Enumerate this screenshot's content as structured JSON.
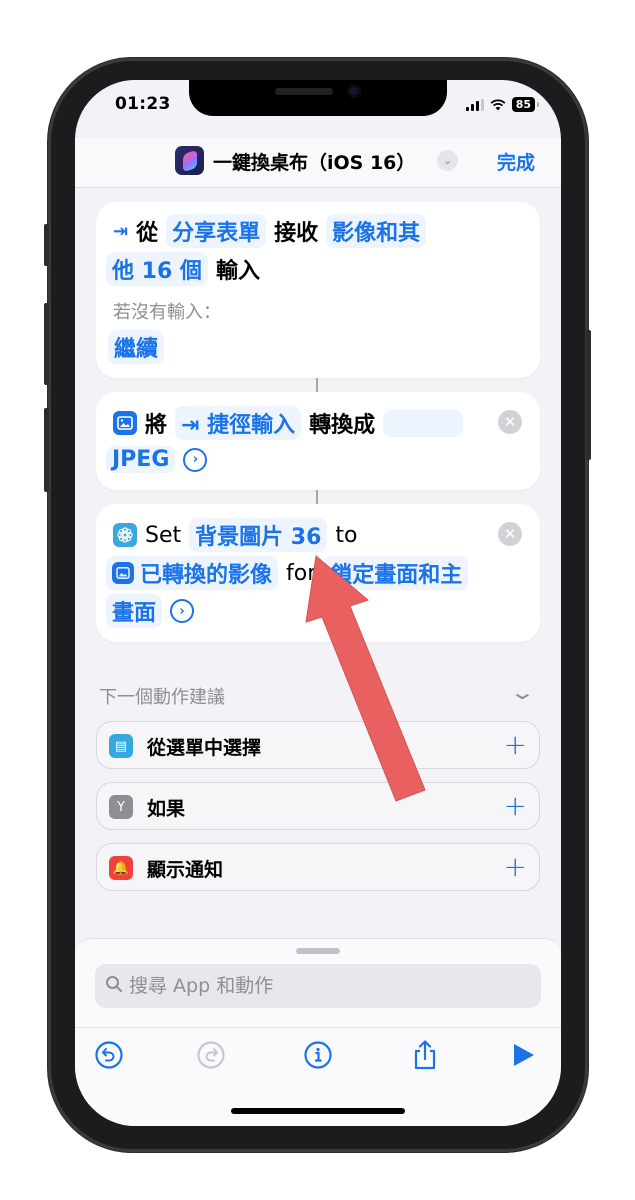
{
  "status_bar": {
    "time": "01:23",
    "battery": "85",
    "signal_bars_filled": 3,
    "signal_bars_total": 4
  },
  "nav": {
    "app_icon": "shortcuts-app-icon",
    "title": "一鍵換桌布（iOS 16）",
    "chevron_icon": "chevron-down-icon",
    "done_label": "完成"
  },
  "actions": [
    {
      "icon": "input-arrow-icon",
      "prefix": "從",
      "source_token": "分享表單",
      "verb": "接收",
      "type_token_line1": "影像和其",
      "type_token_line2": "他 16 個",
      "suffix": "輸入",
      "no_input_label": "若沒有輸入：",
      "no_input_token": "繼續"
    },
    {
      "icon": "photo-icon",
      "prefix": "將",
      "input_token": "捷徑輸入",
      "verb": "轉換成",
      "format_token": "JPEG"
    },
    {
      "icon": "wallpaper-flower-icon",
      "prefix": "Set",
      "wallpaper_token": "背景圖片 36",
      "to_label": "to",
      "image_token": "已轉換的影像",
      "for_label": "for",
      "target_token_line1": "鎖定畫面和主",
      "target_token_line2": "畫面"
    }
  ],
  "suggestions": {
    "header": "下一個動作建議",
    "items": [
      {
        "label": "從選單中選擇",
        "icon": "menu-list-icon",
        "color": "#35a8e0"
      },
      {
        "label": "如果",
        "icon": "branch-icon",
        "color": "#8e8e93"
      },
      {
        "label": "顯示通知",
        "icon": "notification-bell-icon",
        "color": "#f0413a"
      }
    ],
    "add_symbol": "+"
  },
  "search": {
    "placeholder": "搜尋 App 和動作",
    "value": ""
  },
  "toolbar": {
    "undo": "undo-icon",
    "redo": "redo-icon",
    "info": "info-icon",
    "share": "share-icon",
    "run": "play-icon"
  },
  "colors": {
    "accent": "#1a73e8",
    "annotation_arrow": "#e8605f"
  }
}
